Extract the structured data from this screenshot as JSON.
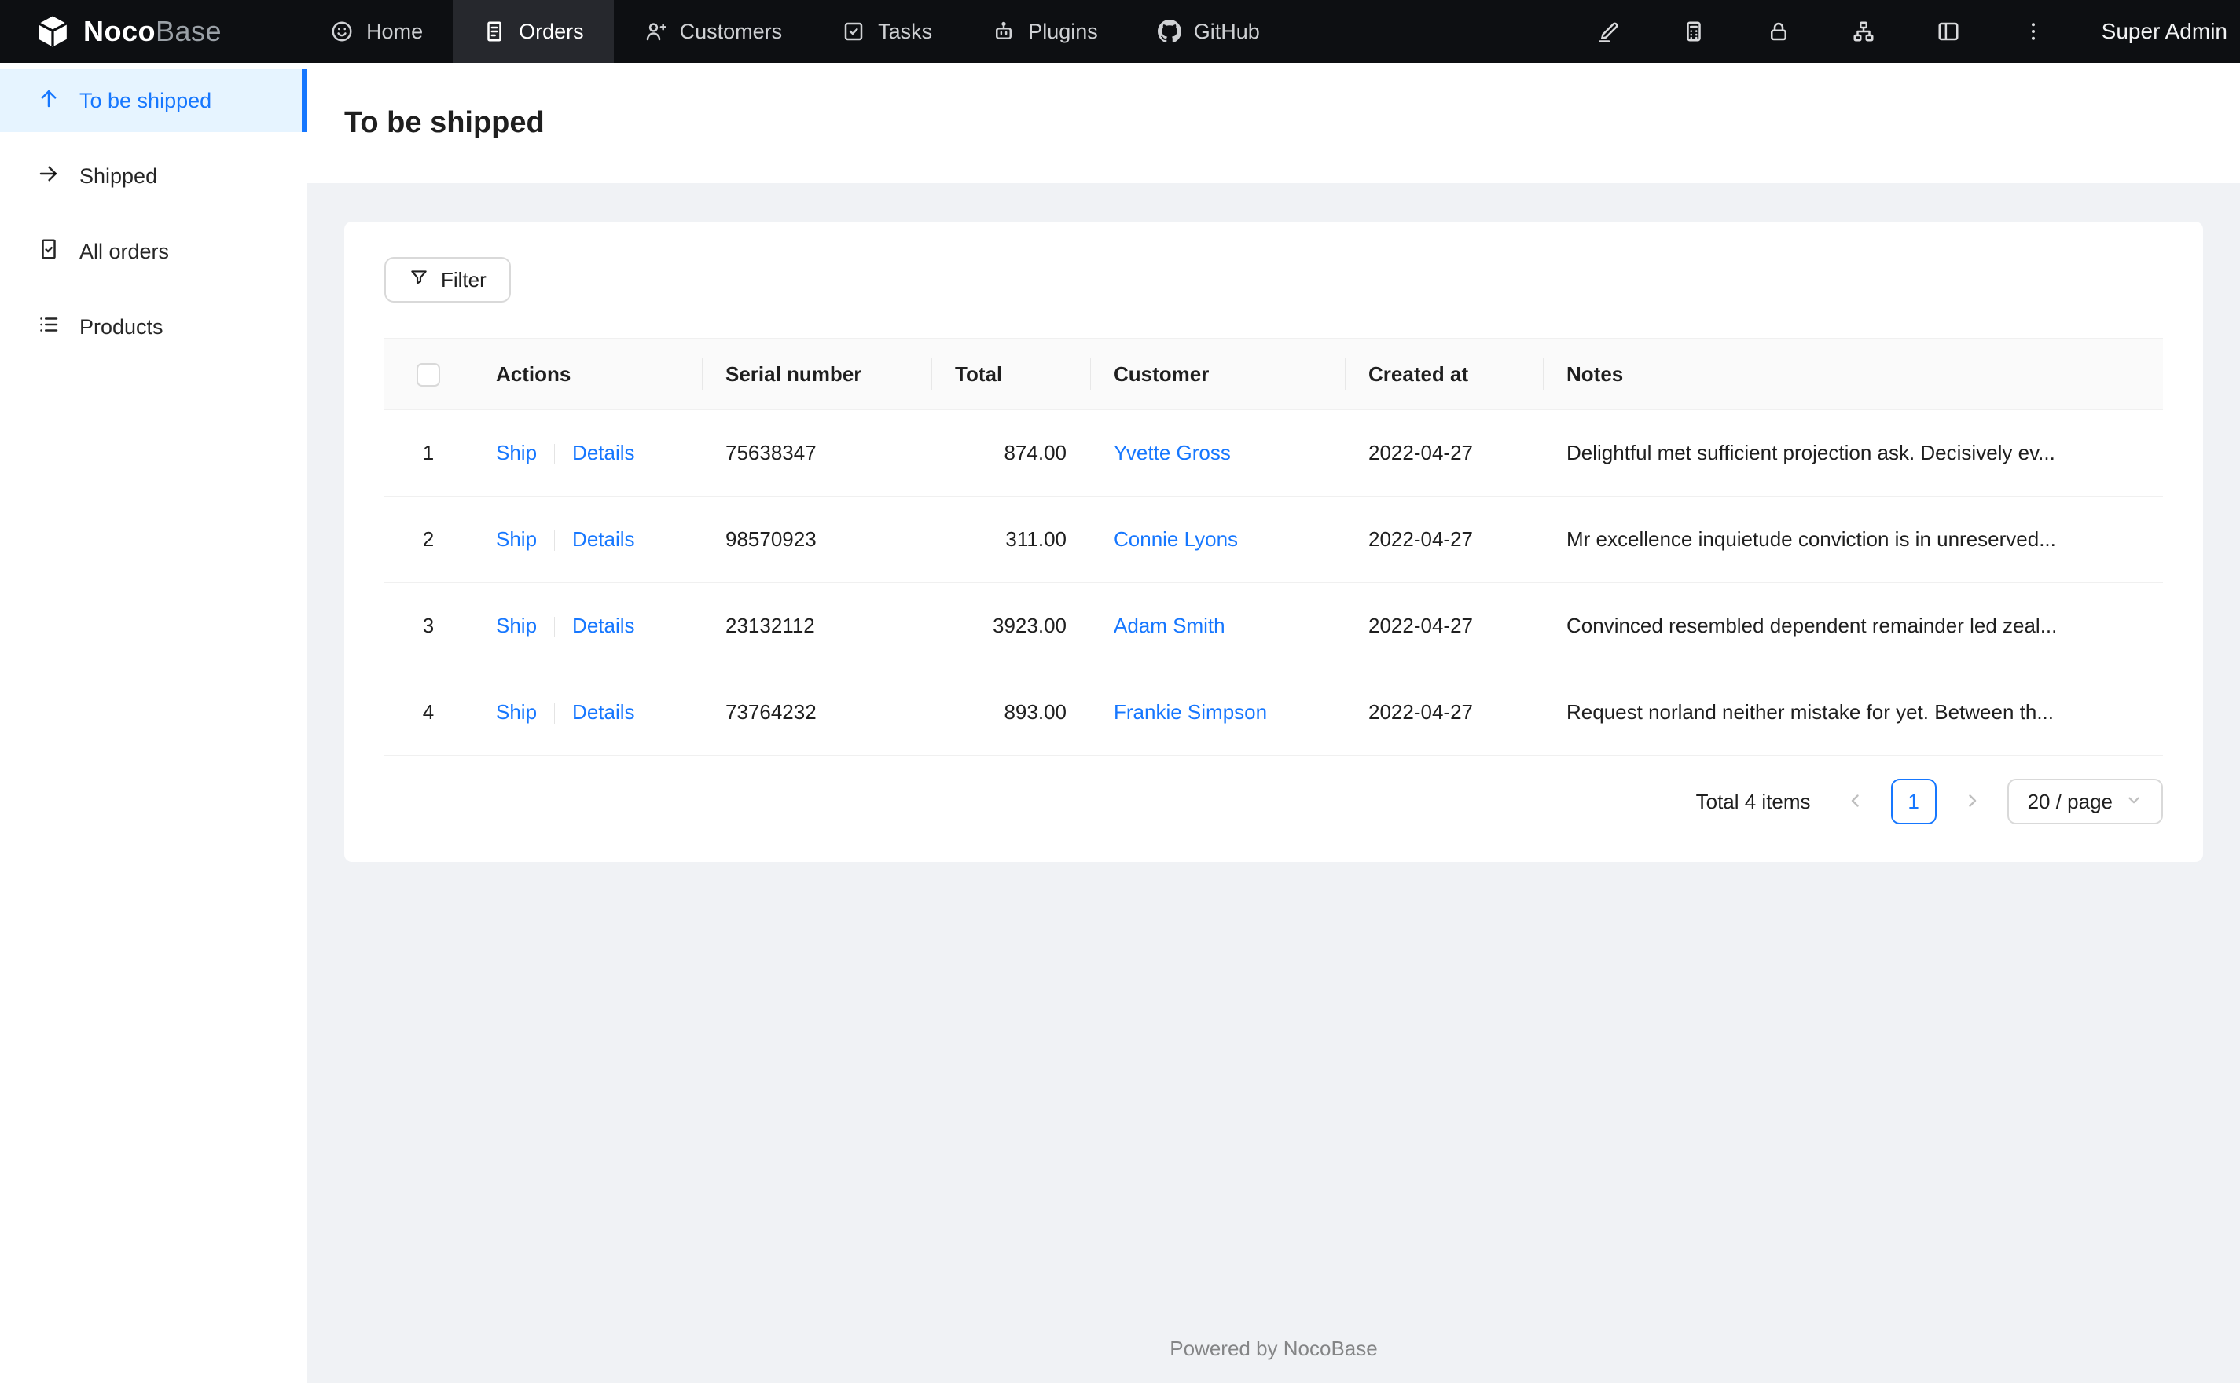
{
  "navbar": {
    "brand": {
      "bold": "Noco",
      "light": "Base",
      "logo_icon": "nocobase-logo-icon"
    },
    "items": [
      {
        "label": "Home",
        "icon": "home-icon",
        "active": false
      },
      {
        "label": "Orders",
        "icon": "orders-icon",
        "active": true
      },
      {
        "label": "Customers",
        "icon": "customers-icon",
        "active": false
      },
      {
        "label": "Tasks",
        "icon": "tasks-icon",
        "active": false
      },
      {
        "label": "Plugins",
        "icon": "plugins-icon",
        "active": false
      },
      {
        "label": "GitHub",
        "icon": "github-icon",
        "active": false
      }
    ],
    "right": {
      "icons": [
        "highlighter-icon",
        "calculator-icon",
        "lock-icon",
        "org-chart-icon",
        "layout-icon",
        "kebab-menu-icon"
      ],
      "user": "Super Admin"
    }
  },
  "sidebar": {
    "items": [
      {
        "label": "To be shipped",
        "icon": "arrow-up-icon",
        "active": true
      },
      {
        "label": "Shipped",
        "icon": "arrow-right-icon",
        "active": false
      },
      {
        "label": "All orders",
        "icon": "file-done-icon",
        "active": false
      },
      {
        "label": "Products",
        "icon": "list-icon",
        "active": false
      }
    ]
  },
  "page": {
    "title": "To be shipped"
  },
  "toolbar": {
    "filter_label": "Filter",
    "filter_icon": "filter-icon"
  },
  "table": {
    "columns": [
      "",
      "Actions",
      "Serial number",
      "Total",
      "Customer",
      "Created at",
      "Notes"
    ],
    "action_labels": {
      "ship": "Ship",
      "details": "Details"
    },
    "rows": [
      {
        "index": "1",
        "serial": "75638347",
        "total": "874.00",
        "customer": "Yvette Gross",
        "created_at": "2022-04-27",
        "notes": "Delightful met sufficient projection ask. Decisively ev..."
      },
      {
        "index": "2",
        "serial": "98570923",
        "total": "311.00",
        "customer": "Connie Lyons",
        "created_at": "2022-04-27",
        "notes": "Mr excellence inquietude conviction is in unreserved..."
      },
      {
        "index": "3",
        "serial": "23132112",
        "total": "3923.00",
        "customer": "Adam Smith",
        "created_at": "2022-04-27",
        "notes": "Convinced resembled dependent remainder led zeal..."
      },
      {
        "index": "4",
        "serial": "73764232",
        "total": "893.00",
        "customer": "Frankie Simpson",
        "created_at": "2022-04-27",
        "notes": "Request norland neither mistake for yet. Between th..."
      }
    ]
  },
  "pagination": {
    "total_text": "Total 4 items",
    "current_page": "1",
    "page_size": "20 / page"
  },
  "footer": {
    "text": "Powered by NocoBase"
  },
  "colors": {
    "accent": "#1677ff",
    "navbar_bg": "#0d0f12",
    "navbar_active_bg": "#26282d",
    "sidebar_active_bg": "#e6f4ff",
    "content_bg": "#f0f2f5",
    "border": "#f0f0f0",
    "control_border": "#d9d9d9",
    "link": "#1677ff"
  }
}
